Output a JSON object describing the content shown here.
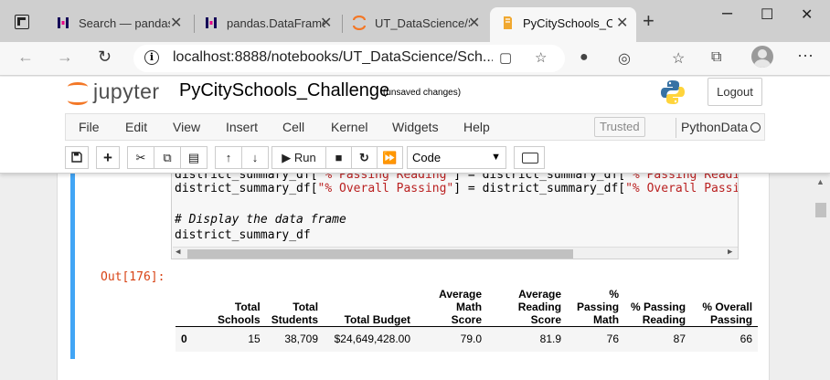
{
  "browser": {
    "tabs": [
      {
        "title": "Search — pandas",
        "active": false
      },
      {
        "title": "pandas.DataFrame",
        "active": false
      },
      {
        "title": "UT_DataScience/S",
        "active": false
      },
      {
        "title": "PyCitySchools_Che",
        "active": true
      }
    ],
    "url": "localhost:8888/notebooks/UT_DataScience/Sch...",
    "colors": {
      "accent": "#f37726",
      "cell_selected": "#42a5f5",
      "prompt_out": "#d84315"
    }
  },
  "jupyter": {
    "logo_text": "jupyter",
    "notebook_name": "PyCitySchools_Challenge",
    "save_status": "(unsaved changes)",
    "logout_label": "Logout",
    "menu": [
      "File",
      "Edit",
      "View",
      "Insert",
      "Cell",
      "Kernel",
      "Widgets",
      "Help"
    ],
    "trusted_label": "Trusted",
    "kernel_name": "PythonData",
    "toolbar": {
      "run_label": "Run",
      "cell_type": "Code"
    }
  },
  "cell": {
    "code_lines": {
      "line1_a": "district_summary_df[",
      "line1_b": "\"% Passing Reading\"",
      "line1_c": "] = district_summary_df[",
      "line1_d": "\"% Passing Readin",
      "line2_a": "district_summary_df[",
      "line2_b": "\"% Overall Passing\"",
      "line2_c": "] = district_summary_df[",
      "line2_d": "\"% Overall Passing",
      "comment": "# Display the data frame",
      "line4": "district_summary_df"
    },
    "output_prompt": "Out[176]:",
    "table": {
      "headers": [
        [
          "Total",
          "Schools"
        ],
        [
          "Total",
          "Students"
        ],
        [
          "Total Budget"
        ],
        [
          "Average",
          "Math",
          "Score"
        ],
        [
          "Average",
          "Reading",
          "Score"
        ],
        [
          "%",
          "Passing",
          "Math"
        ],
        [
          "% Passing",
          "Reading"
        ],
        [
          "% Overall",
          "Passing"
        ]
      ],
      "rows": [
        [
          "0",
          "15",
          "38,709",
          "$24,649,428.00",
          "79.0",
          "81.9",
          "76",
          "87",
          "66"
        ]
      ]
    }
  }
}
